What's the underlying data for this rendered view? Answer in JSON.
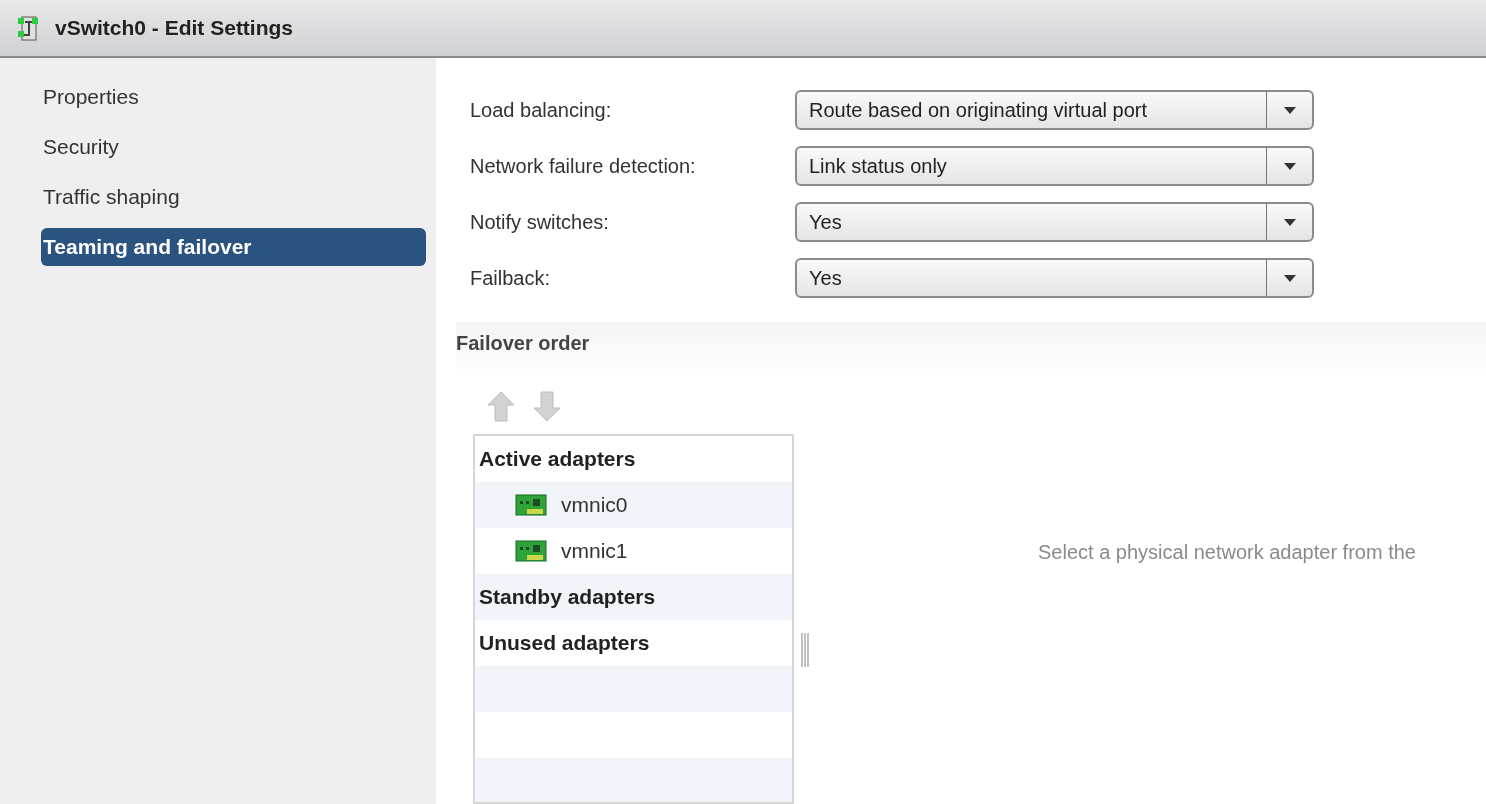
{
  "window": {
    "title": "vSwitch0 - Edit Settings"
  },
  "sidebar": {
    "items": [
      {
        "label": "Properties",
        "selected": false
      },
      {
        "label": "Security",
        "selected": false
      },
      {
        "label": "Traffic shaping",
        "selected": false
      },
      {
        "label": "Teaming and failover",
        "selected": true
      }
    ]
  },
  "settings": [
    {
      "label": "Load balancing:",
      "value": "Route based on originating virtual port"
    },
    {
      "label": "Network failure detection:",
      "value": "Link status only"
    },
    {
      "label": "Notify switches:",
      "value": "Yes"
    },
    {
      "label": "Failback:",
      "value": "Yes"
    }
  ],
  "failover_order": {
    "title": "Failover order",
    "move_buttons": [
      {
        "kind": "up",
        "disabled": true
      },
      {
        "kind": "down",
        "disabled": true
      }
    ],
    "rows": [
      {
        "kind": "group",
        "label": "Active adapters"
      },
      {
        "kind": "adapter",
        "label": "vmnic0"
      },
      {
        "kind": "adapter",
        "label": "vmnic1"
      },
      {
        "kind": "group",
        "label": "Standby adapters"
      },
      {
        "kind": "group",
        "label": "Unused adapters"
      }
    ],
    "hint": "Select a physical network adapter from the"
  }
}
